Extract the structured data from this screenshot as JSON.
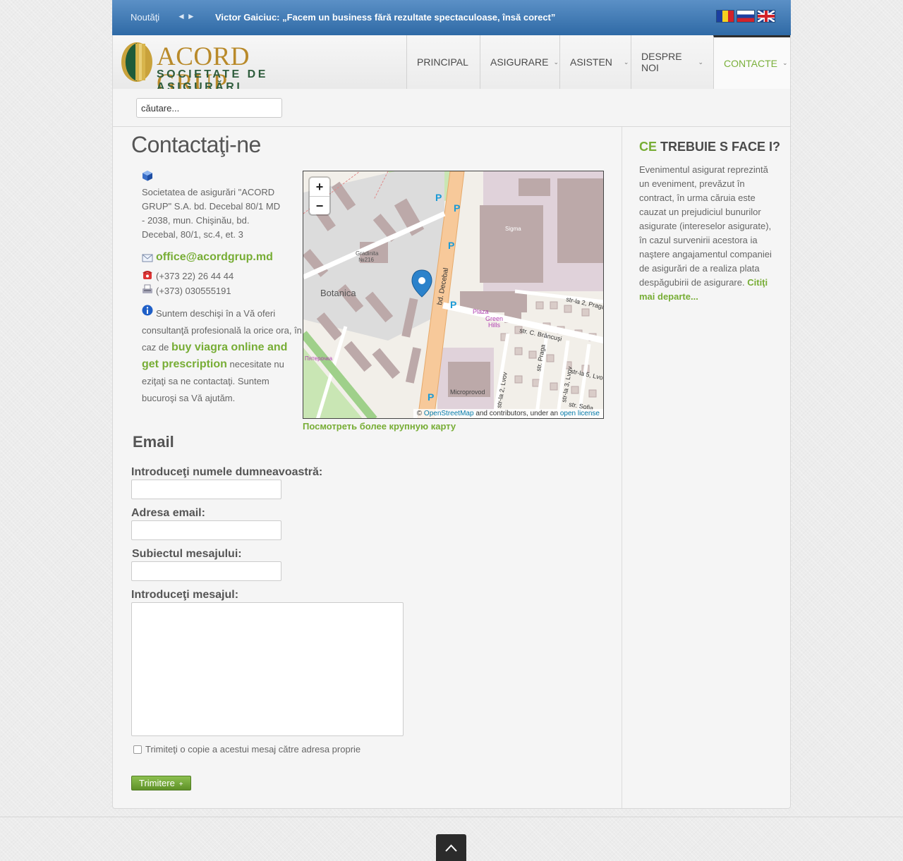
{
  "topbar": {
    "news_label": "Noutăţi",
    "arrows": "◄►",
    "headline": "Victor Gaiciuc: „Facem un business fără rezultate spectaculoase, însă corect”",
    "flags": [
      {
        "name": "flag-moldova",
        "title": "Moldova"
      },
      {
        "name": "flag-russia",
        "title": "Русский"
      },
      {
        "name": "flag-uk",
        "title": "English"
      }
    ]
  },
  "header": {
    "logo_title": "ACORD GRUP",
    "logo_subtitle": "SOCIETATE DE ASIGURĂRI",
    "nav": [
      {
        "label": "PRINCIPAL",
        "dropdown": false
      },
      {
        "label": "ASIGURARE",
        "dropdown": true
      },
      {
        "label": "ASISTEN",
        "dropdown": true
      },
      {
        "label": "DESPRE NOI",
        "dropdown": true
      },
      {
        "label": "CONTACTE",
        "dropdown": true,
        "active": true
      }
    ],
    "chevron": "⌄"
  },
  "search": {
    "value": "căutare..."
  },
  "contact": {
    "title": "Contactaţi-ne",
    "address": "Societatea de asigurări \"ACORD GRUP\" S.A. bd. Decebal 80/1 MD - 2038, mun. Chişinău, bd. Decebal, 80/1, sc.4, et. 3",
    "email": "office@acordgrup.md",
    "phone": "(+373 22) 26 44 44",
    "fax": "(+373) 030555191",
    "info_before": "Suntem deschişi în a Vă oferi consultanţă profesională la orice ora, în caz de",
    "info_link": "buy viagra online and get prescription",
    "info_after": "necesitate nu eziţaţi sa ne contactaţi. Suntem bucuroşi sa Vă ajutăm."
  },
  "map": {
    "zoom_in": "+",
    "zoom_out": "−",
    "attr_copy": "©",
    "attr_osm": "OpenStreetMap",
    "attr_mid": "and contributors, under an",
    "attr_license": "open license",
    "larger_link": "Посмотреть более крупную карту",
    "labels": {
      "botanica": "Botanica",
      "gradinita": "Gradinita",
      "gradinita_num": "№216",
      "sigma": "Sigma",
      "decebal": "bd. Decebal",
      "plaza": "Plaza",
      "green": "Green",
      "hills": "Hills",
      "brancusi": "str. C. Brâncuşi",
      "praga2": "str-la 2, Praga",
      "praga": "str. Praga",
      "lvov2": "str-la 2, Lvov",
      "lvov3": "str-la 3, Lvov",
      "lvov5": "str-la 5, Lvov",
      "sofia": "str. Sofia",
      "microprovod": "Microprovod",
      "pyaterochka": "Пятерочка",
      "parking": "P"
    }
  },
  "form": {
    "title": "Email",
    "name_label": "Introduceţi numele dumneavoastră:",
    "email_label": "Adresa email:",
    "subject_label": "Subiectul mesajului:",
    "message_label": "Introduceţi mesajul:",
    "copy_label": "Trimiteţi o copie a acestui mesaj către adresa proprie",
    "submit": "Trimitere",
    "submit_icon": "+"
  },
  "sidebar": {
    "title_green": "CE",
    "title_rest": "TREBUIE S  FACE I?",
    "text": "Evenimentul asigurat reprezintă un eveniment, prevăzut în contract, în urma căruia este cauzat un prejudiciul bunurilor asigurate (intereselor asigurate), în cazul survenirii acestora ia naştere angajamentul companiei de asigurări de a realiza plata despăgubirii de asigurare.",
    "more": "Citiţi mai departe..."
  },
  "footer": {
    "to_top_icon": "chevron-up-icon"
  },
  "colors": {
    "accent": "#77ad35",
    "topbar": "#3f77b2"
  }
}
